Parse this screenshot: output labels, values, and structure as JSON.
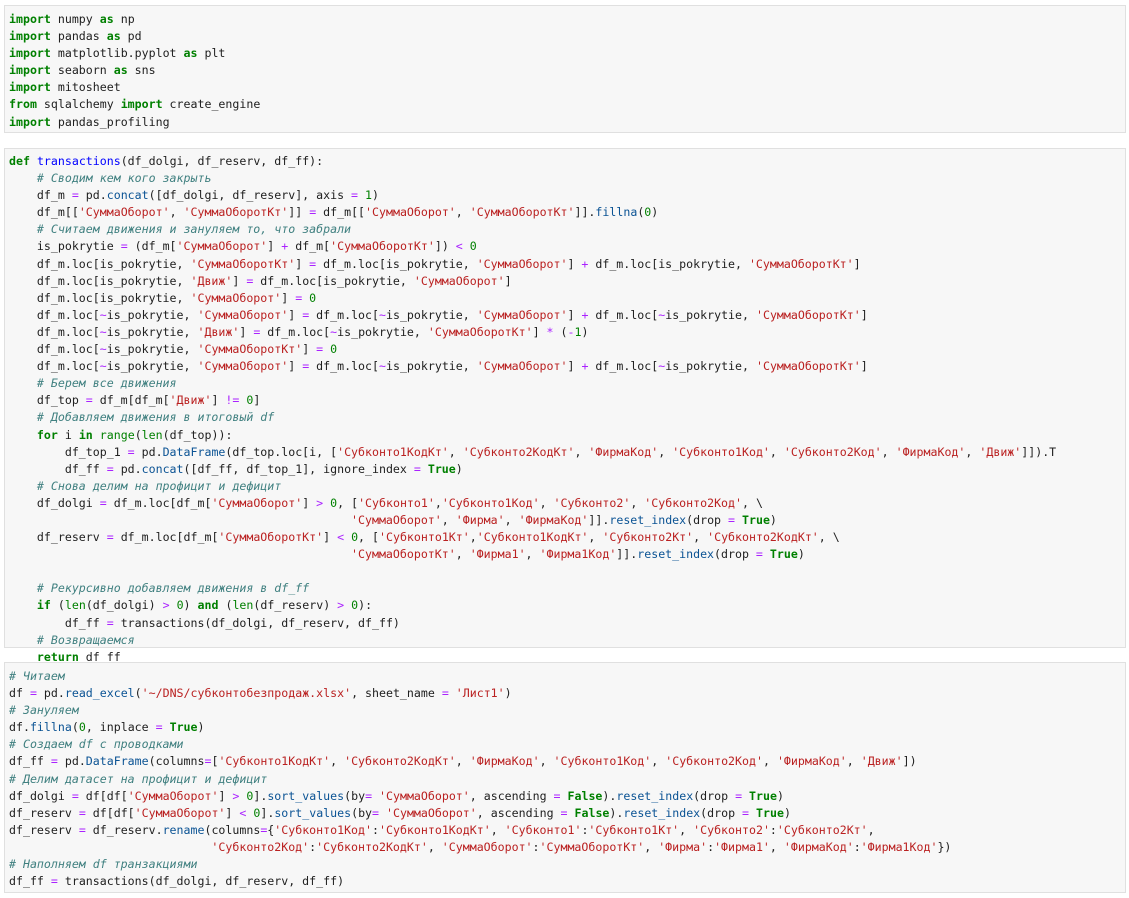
{
  "cells": [
    {
      "lines": [
        "import numpy as np",
        "import pandas as pd",
        "import matplotlib.pyplot as plt",
        "import seaborn as sns",
        "import mitosheet",
        "from sqlalchemy import create_engine",
        "import pandas_profiling"
      ]
    },
    {
      "lines": [
        "def transactions(df_dolgi, df_reserv, df_ff):",
        "    # Сводим кем кого закрыть",
        "    df_m = pd.concat([df_dolgi, df_reserv], axis = 1)",
        "    df_m[['СуммаОборот', 'СуммаОборотКт']] = df_m[['СуммаОборот', 'СуммаОборотКт']].fillna(0)",
        "    # Считаем движения и зануляем то, что забрали",
        "    is_pokrytie = (df_m['СуммаОборот'] + df_m['СуммаОборотКт']) < 0",
        "    df_m.loc[is_pokrytie, 'СуммаОборотКт'] = df_m.loc[is_pokrytie, 'СуммаОборот'] + df_m.loc[is_pokrytie, 'СуммаОборотКт']",
        "    df_m.loc[is_pokrytie, 'Движ'] = df_m.loc[is_pokrytie, 'СуммаОборот']",
        "    df_m.loc[is_pokrytie, 'СуммаОборот'] = 0",
        "    df_m.loc[~is_pokrytie, 'СуммаОборот'] = df_m.loc[~is_pokrytie, 'СуммаОборот'] + df_m.loc[~is_pokrytie, 'СуммаОборотКт']",
        "    df_m.loc[~is_pokrytie, 'Движ'] = df_m.loc[~is_pokrytie, 'СуммаОборотКт'] * (-1)",
        "    df_m.loc[~is_pokrytie, 'СуммаОборотКт'] = 0",
        "    df_m.loc[~is_pokrytie, 'СуммаОборот'] = df_m.loc[~is_pokrytie, 'СуммаОборот'] + df_m.loc[~is_pokrytie, 'СуммаОборотКт']",
        "    # Берем все движения",
        "    df_top = df_m[df_m['Движ'] != 0]",
        "    # Добавляем движения в итоговый df",
        "    for i in range(len(df_top)):",
        "        df_top_1 = pd.DataFrame(df_top.loc[i, ['Субконто1КодКт', 'Субконто2КодКт', 'ФирмаКод', 'Субконто1Код', 'Субконто2Код', 'ФирмаКод', 'Движ']]).T",
        "        df_ff = pd.concat([df_ff, df_top_1], ignore_index = True)",
        "    # Снова делим на профицит и дефицит",
        "    df_dolgi = df_m.loc[df_m['СуммаОборот'] > 0, ['Субконто1','Субконто1Код', 'Субконто2', 'Субконто2Код', \\",
        "                                                 'СуммаОборот', 'Фирма', 'ФирмаКод']].reset_index(drop = True)",
        "    df_reserv = df_m.loc[df_m['СуммаОборотКт'] < 0, ['Субконто1Кт','Субконто1КодКт', 'Субконто2Кт', 'Субконто2КодКт', \\",
        "                                                 'СуммаОборотКт', 'Фирма1', 'Фирма1Код']].reset_index(drop = True)",
        "",
        "    # Рекурсивно добавляем движения в df_ff",
        "    if (len(df_dolgi) > 0) and (len(df_reserv) > 0):",
        "        df_ff = transactions(df_dolgi, df_reserv, df_ff)",
        "    # Возвращаемся",
        "    return df_ff"
      ]
    },
    {
      "lines": [
        "# Читаем",
        "df = pd.read_excel('~/DNS/субконтобезпродаж.xlsx', sheet_name = 'Лист1')",
        "# Зануляем",
        "df.fillna(0, inplace = True)",
        "# Создаем df с проводками",
        "df_ff = pd.DataFrame(columns=['Субконто1КодКт', 'Субконто2КодКт', 'ФирмаКод', 'Субконто1Код', 'Субконто2Код', 'ФирмаКод', 'Движ'])",
        "# Делим датасет на профицит и дефицит",
        "df_dolgi = df[df['СуммаОборот'] > 0].sort_values(by= 'СуммаОборот', ascending = False).reset_index(drop = True)",
        "df_reserv = df[df['СуммаОборот'] < 0].sort_values(by= 'СуммаОборот', ascending = False).reset_index(drop = True)",
        "df_reserv = df_reserv.rename(columns={'Субконто1Код':'Субконто1КодКт', 'Субконто1':'Субконто1Кт', 'Субконто2':'Субконто2Кт',",
        "                             'Субконто2Код':'Субконто2КодКт', 'СуммаОборот':'СуммаОборотКт', 'Фирма':'Фирма1', 'ФирмаКод':'Фирма1Код'})",
        "# Наполняем df транзакциями",
        "df_ff = transactions(df_dolgi, df_reserv, df_ff)"
      ]
    }
  ]
}
